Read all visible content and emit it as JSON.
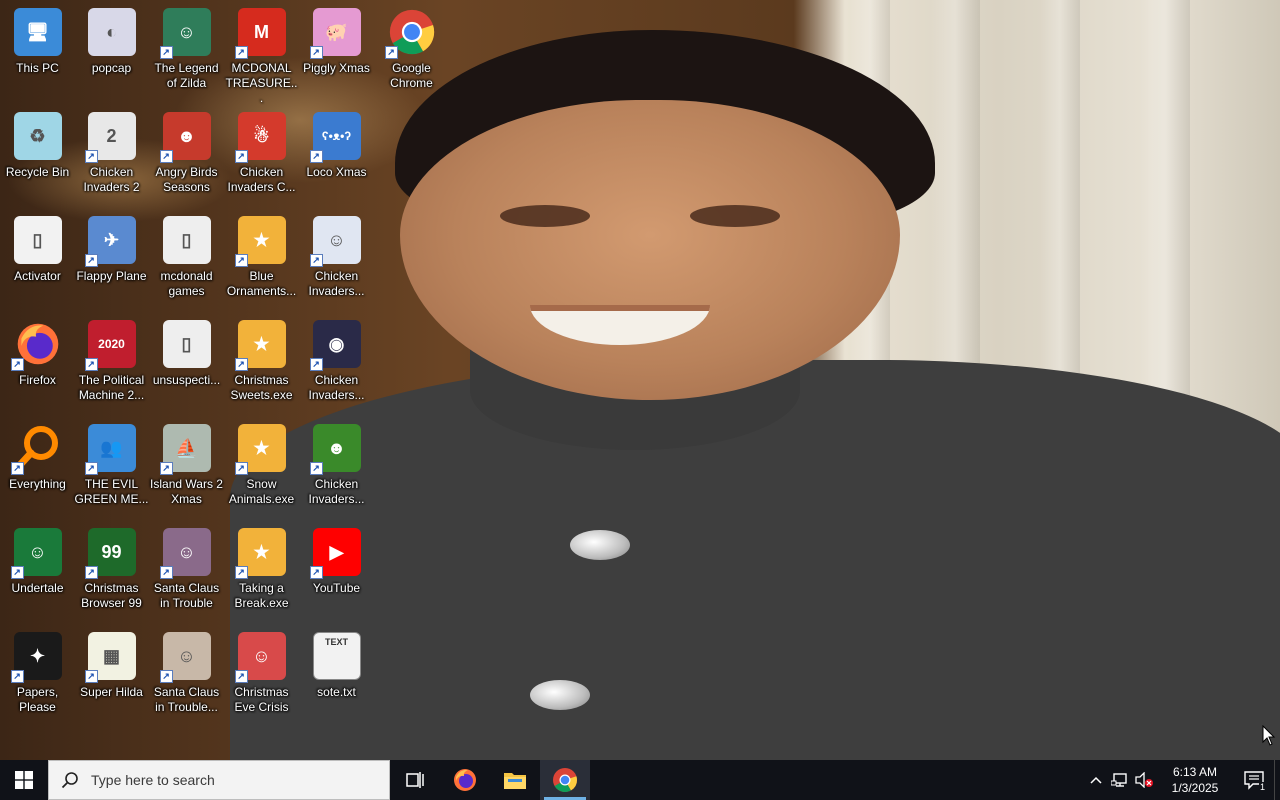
{
  "desktop": {
    "icons": [
      {
        "label": "This PC",
        "icon": "computer-icon",
        "color": "#3b8bd8",
        "glyph": "🖥"
      },
      {
        "label": "popcap",
        "icon": "folder-image-icon",
        "color": "#d8d8e8",
        "glyph": "◐"
      },
      {
        "label": "The Legend of Zilda",
        "icon": "game-character-icon",
        "color": "#2f7d5a",
        "glyph": "☺"
      },
      {
        "label": "MCDONAL TREASURE...",
        "icon": "mcdonalds-icon",
        "color": "#d62b1e",
        "glyph": "M"
      },
      {
        "label": "Piggly Xmas",
        "icon": "pig-icon",
        "color": "#e59ad2",
        "glyph": "🐖"
      },
      {
        "label": "Google Chrome",
        "icon": "chrome-icon",
        "color": "#ffffff",
        "glyph": "chrome"
      },
      {
        "label": "Recycle Bin",
        "icon": "recycle-bin-icon",
        "color": "#9fd6e6",
        "glyph": "♻"
      },
      {
        "label": "Chicken Invaders 2",
        "icon": "chicken-icon",
        "color": "#e8e8e8",
        "glyph": "2"
      },
      {
        "label": "Angry Birds Seasons",
        "icon": "angry-birds-icon",
        "color": "#c63a2c",
        "glyph": "☻"
      },
      {
        "label": "Chicken Invaders C...",
        "icon": "chicken-icon",
        "color": "#d43a2c",
        "glyph": "☃"
      },
      {
        "label": "Loco Xmas",
        "icon": "bear-icon",
        "color": "#3b7bd0",
        "glyph": "ʕ•ᴥ•ʔ"
      },
      {
        "label": "Activator",
        "icon": "file-icon",
        "color": "#f2f2f2",
        "glyph": "▯"
      },
      {
        "label": "Flappy Plane",
        "icon": "plane-icon",
        "color": "#5a8ad0",
        "glyph": "✈"
      },
      {
        "label": "mcdonald games",
        "icon": "folder-icon",
        "color": "#eeeeee",
        "glyph": "▯"
      },
      {
        "label": "Blue Ornaments...",
        "icon": "app-icon",
        "color": "#f2b23a",
        "glyph": "★"
      },
      {
        "label": "Chicken Invaders...",
        "icon": "chicken-icon",
        "color": "#e0e6f2",
        "glyph": "☺"
      },
      {
        "label": "Firefox",
        "icon": "firefox-icon",
        "color": "#ff7139",
        "glyph": "firefox"
      },
      {
        "label": "The Political Machine 2...",
        "icon": "political-machine-icon",
        "color": "#c01e2e",
        "glyph": "2020"
      },
      {
        "label": "unsuspecti...",
        "icon": "folder-icon",
        "color": "#eeeeee",
        "glyph": "▯"
      },
      {
        "label": "Christmas Sweets.exe",
        "icon": "app-icon",
        "color": "#f2b23a",
        "glyph": "★"
      },
      {
        "label": "Chicken Invaders...",
        "icon": "chicken-icon",
        "color": "#2a2a48",
        "glyph": "◉"
      },
      {
        "label": "Everything",
        "icon": "search-icon",
        "color": "#ff8a00",
        "glyph": "everything"
      },
      {
        "label": "THE EVIL GREEN ME...",
        "icon": "people-icon",
        "color": "#3b8bd8",
        "glyph": "👥"
      },
      {
        "label": "Island Wars 2 Xmas",
        "icon": "island-icon",
        "color": "#aebab0",
        "glyph": "⛵"
      },
      {
        "label": "Snow Animals.exe",
        "icon": "app-icon",
        "color": "#f2b23a",
        "glyph": "★"
      },
      {
        "label": "Chicken Invaders...",
        "icon": "chicken-icon",
        "color": "#3a8a2a",
        "glyph": "☻"
      },
      {
        "label": "Undertale",
        "icon": "undertale-icon",
        "color": "#1a7a3a",
        "glyph": "☺"
      },
      {
        "label": "Christmas Browser 99",
        "icon": "christmas-tree-icon",
        "color": "#1e6a2a",
        "glyph": "99"
      },
      {
        "label": "Santa Claus in Trouble",
        "icon": "santa-icon",
        "color": "#8a6a8a",
        "glyph": "☺"
      },
      {
        "label": "Taking a Break.exe",
        "icon": "app-icon",
        "color": "#f2b23a",
        "glyph": "★"
      },
      {
        "label": "YouTube",
        "icon": "youtube-icon",
        "color": "#ff0000",
        "glyph": "▶"
      },
      {
        "label": "Papers, Please",
        "icon": "papers-please-icon",
        "color": "#1a1a1a",
        "glyph": "✦"
      },
      {
        "label": "Super Hilda",
        "icon": "pixel-character-icon",
        "color": "#f2f2e2",
        "glyph": "▦"
      },
      {
        "label": "Santa Claus in Trouble...",
        "icon": "santa-icon",
        "color": "#c8b8a8",
        "glyph": "☺"
      },
      {
        "label": "Christmas Eve Crisis",
        "icon": "santa-face-icon",
        "color": "#d84a4a",
        "glyph": "☺"
      },
      {
        "label": "sote.txt",
        "icon": "text-file-icon",
        "color": "#f2f2f2",
        "glyph": "TEXT"
      }
    ]
  },
  "taskbar": {
    "search_placeholder": "Type here to search",
    "pinned": [
      {
        "name": "task-view",
        "icon": "task-view-icon"
      },
      {
        "name": "firefox",
        "icon": "firefox-icon"
      },
      {
        "name": "file-explorer",
        "icon": "folder-icon"
      },
      {
        "name": "chrome",
        "icon": "chrome-icon"
      }
    ],
    "clock": {
      "time": "6:13 AM",
      "date": "1/3/2025"
    },
    "notification_count": "1",
    "colors": {
      "bar": "#101218",
      "active_underline": "#6fb2e6"
    }
  }
}
